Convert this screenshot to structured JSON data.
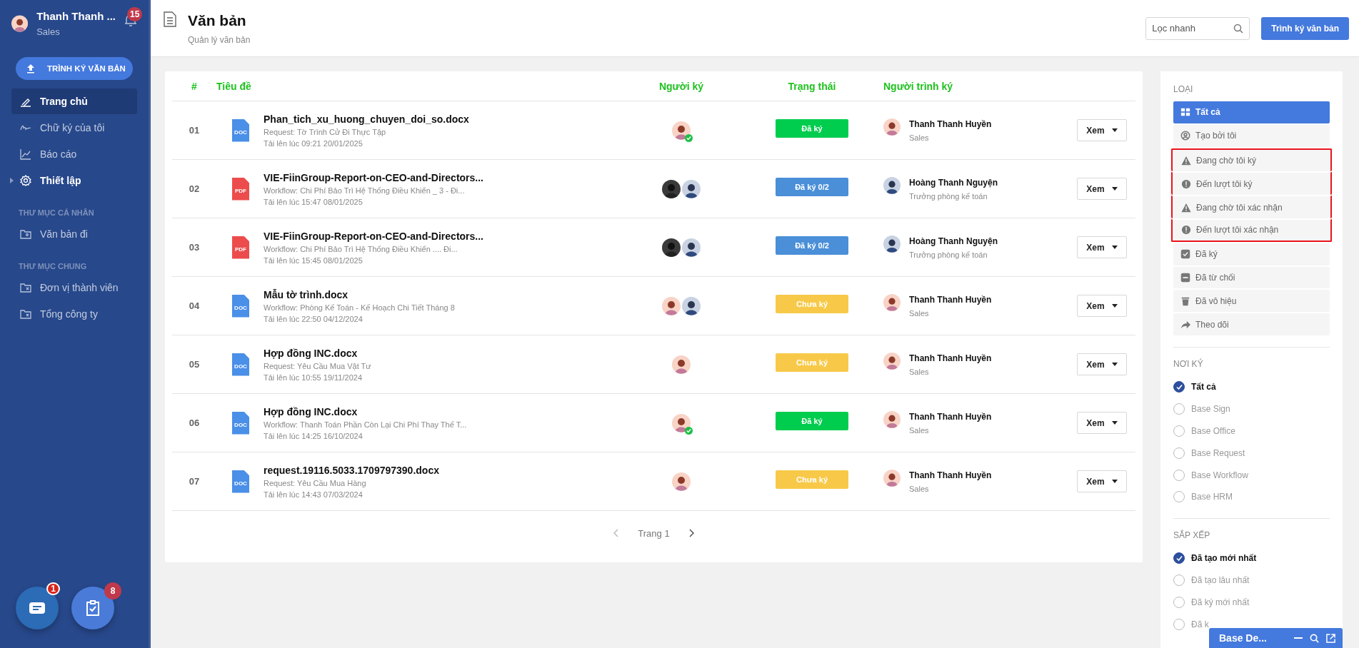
{
  "sidebar": {
    "user": {
      "name": "Thanh Thanh ...",
      "role": "Sales",
      "notifications": "15"
    },
    "primary_button": "TRÌNH KÝ VĂN BẢN",
    "nav": [
      {
        "kind": "home",
        "label": "Trang chủ",
        "selected": true
      },
      {
        "kind": "signature",
        "label": "Chữ ký của tôi",
        "selected": false
      },
      {
        "kind": "report",
        "label": "Báo cáo",
        "selected": false
      },
      {
        "kind": "settings",
        "label": "Thiết lập",
        "selected": false,
        "expanded": false
      },
      {
        "kind": "section",
        "label": "THƯ MỤC CÁ NHÂN"
      },
      {
        "kind": "personal-folder",
        "label": "Văn bản đi",
        "selected": false
      },
      {
        "kind": "section",
        "label": "THƯ MỤC CHUNG"
      },
      {
        "kind": "shared-folder",
        "label": "Đơn vị thành viên",
        "selected": false
      },
      {
        "kind": "shared-folder",
        "label": "Tổng công ty",
        "selected": false
      }
    ],
    "floating": [
      {
        "kind": "chat",
        "badge": "1"
      },
      {
        "kind": "tasks",
        "badge": "8"
      }
    ]
  },
  "header": {
    "title": "Văn bản",
    "subtitle": "Quản lý văn bản",
    "search": {
      "placeholder": "Lọc nhanh"
    },
    "button": "Trình ký văn bản"
  },
  "table": {
    "columns": [
      "#",
      "Tiêu đề",
      "Người ký",
      "Trạng thái",
      "Người trình ký"
    ],
    "rows": [
      {
        "index": "01",
        "file": {
          "kind": "doc",
          "label": "DOC"
        },
        "title": "Phan_tich_xu_huong_chuyen_doi_so.docx",
        "source": "Request: Tờ Trình Cử Đi Thực Tập",
        "uploaded": "Tải lên lúc 09:21 20/01/2025",
        "signers": [
          {
            "kind": "woman",
            "signed": true
          }
        ],
        "status": {
          "kind": "signed",
          "label": "Đã ký"
        },
        "submitter": {
          "kind": "woman",
          "name": "Thanh Thanh Huyền",
          "role": "Sales"
        },
        "action": "Xem"
      },
      {
        "index": "02",
        "file": {
          "kind": "pdf",
          "label": "PDF"
        },
        "title": "VIE-FiinGroup-Report-on-CEO-and-Directors...",
        "source": "Workflow: Chi Phí Bảo Trì Hệ Thống Điều Khiển _ 3 - Đi...",
        "uploaded": "Tải lên lúc 15:47 08/01/2025",
        "signers": [
          {
            "kind": "dark",
            "signed": false
          },
          {
            "kind": "man",
            "signed": false
          }
        ],
        "status": {
          "kind": "partial",
          "label": "Đã ký 0/2"
        },
        "submitter": {
          "kind": "man",
          "name": "Hoàng Thanh Nguyện",
          "role": "Trưởng phòng kế toán"
        },
        "action": "Xem"
      },
      {
        "index": "03",
        "file": {
          "kind": "pdf",
          "label": "PDF"
        },
        "title": "VIE-FiinGroup-Report-on-CEO-and-Directors...",
        "source": "Workflow: Chi Phí Bảo Trì Hệ Thống Điều Khiển .... Đi...",
        "uploaded": "Tải lên lúc 15:45 08/01/2025",
        "signers": [
          {
            "kind": "dark",
            "signed": false
          },
          {
            "kind": "man",
            "signed": false
          }
        ],
        "status": {
          "kind": "partial",
          "label": "Đã ký 0/2"
        },
        "submitter": {
          "kind": "man",
          "name": "Hoàng Thanh Nguyện",
          "role": "Trưởng phòng kế toán"
        },
        "action": "Xem"
      },
      {
        "index": "04",
        "file": {
          "kind": "doc",
          "label": "DOC"
        },
        "title": "Mẫu tờ trình.docx",
        "source": "Workflow: Phòng Kế Toán - Kế Hoạch Chi Tiết Tháng 8",
        "uploaded": "Tải lên lúc 22:50 04/12/2024",
        "signers": [
          {
            "kind": "woman",
            "signed": false
          },
          {
            "kind": "man",
            "signed": false
          }
        ],
        "status": {
          "kind": "unsigned",
          "label": "Chưa ký"
        },
        "submitter": {
          "kind": "woman",
          "name": "Thanh Thanh Huyền",
          "role": "Sales"
        },
        "action": "Xem"
      },
      {
        "index": "05",
        "file": {
          "kind": "doc",
          "label": "DOC"
        },
        "title": "Hợp đồng INC.docx",
        "source": "Request: Yêu Cầu Mua Vật Tư",
        "uploaded": "Tải lên lúc 10:55 19/11/2024",
        "signers": [
          {
            "kind": "woman",
            "signed": false
          }
        ],
        "status": {
          "kind": "unsigned",
          "label": "Chưa ký"
        },
        "submitter": {
          "kind": "woman",
          "name": "Thanh Thanh Huyền",
          "role": "Sales"
        },
        "action": "Xem"
      },
      {
        "index": "06",
        "file": {
          "kind": "doc",
          "label": "DOC"
        },
        "title": "Hợp đồng INC.docx",
        "source": "Workflow: Thanh Toán Phần Còn Lại Chi Phí Thay Thế T...",
        "uploaded": "Tải lên lúc 14:25 16/10/2024",
        "signers": [
          {
            "kind": "woman",
            "signed": true
          }
        ],
        "status": {
          "kind": "signed",
          "label": "Đã ký"
        },
        "submitter": {
          "kind": "woman",
          "name": "Thanh Thanh Huyền",
          "role": "Sales"
        },
        "action": "Xem"
      },
      {
        "index": "07",
        "file": {
          "kind": "doc",
          "label": "DOC"
        },
        "title": "request.19116.5033.1709797390.docx",
        "source": "Request: Yêu Cầu Mua Hàng",
        "uploaded": "Tải lên lúc 14:43 07/03/2024",
        "signers": [
          {
            "kind": "woman",
            "signed": false
          }
        ],
        "status": {
          "kind": "unsigned",
          "label": "Chưa ký"
        },
        "submitter": {
          "kind": "woman",
          "name": "Thanh Thanh Huyền",
          "role": "Sales"
        },
        "action": "Xem"
      }
    ],
    "pagination": {
      "label": "Trang 1"
    }
  },
  "filters": {
    "type": {
      "title": "LOẠI",
      "items": [
        {
          "kind": "all",
          "label": "Tất cả",
          "selected": true,
          "highlighted": false
        },
        {
          "kind": "mine",
          "label": "Tạo bởi tôi",
          "selected": false,
          "highlighted": false
        },
        {
          "kind": "waiting",
          "label": "Đang chờ tôi ký",
          "selected": false,
          "highlighted": true
        },
        {
          "kind": "turn",
          "label": "Đến lượt tôi ký",
          "selected": false,
          "highlighted": true
        },
        {
          "kind": "waiting",
          "label": "Đang chờ tôi xác nhận",
          "selected": false,
          "highlighted": true
        },
        {
          "kind": "turn",
          "label": "Đến lượt tôi xác nhận",
          "selected": false,
          "highlighted": true
        },
        {
          "kind": "signed",
          "label": "Đã ký",
          "selected": false,
          "highlighted": false
        },
        {
          "kind": "rejected",
          "label": "Đã từ chối",
          "selected": false,
          "highlighted": false
        },
        {
          "kind": "void",
          "label": "Đã vô hiệu",
          "selected": false,
          "highlighted": false
        },
        {
          "kind": "follow",
          "label": "Theo dõi",
          "selected": false,
          "highlighted": false
        }
      ]
    },
    "place": {
      "title": "NƠI KÝ",
      "items": [
        {
          "label": "Tất cả",
          "selected": true
        },
        {
          "label": "Base Sign",
          "selected": false
        },
        {
          "label": "Base Office",
          "selected": false
        },
        {
          "label": "Base Request",
          "selected": false
        },
        {
          "label": "Base Workflow",
          "selected": false
        },
        {
          "label": "Base HRM",
          "selected": false
        }
      ]
    },
    "sort": {
      "title": "SẮP XẾP",
      "items": [
        {
          "label": "Đã tạo mới nhất",
          "selected": true
        },
        {
          "label": "Đã tạo lâu nhất",
          "selected": false
        },
        {
          "label": "Đã ký mới nhất",
          "selected": false
        },
        {
          "label": "Đã k",
          "selected": false
        }
      ]
    }
  },
  "chat_bar": {
    "title": "Base De..."
  }
}
